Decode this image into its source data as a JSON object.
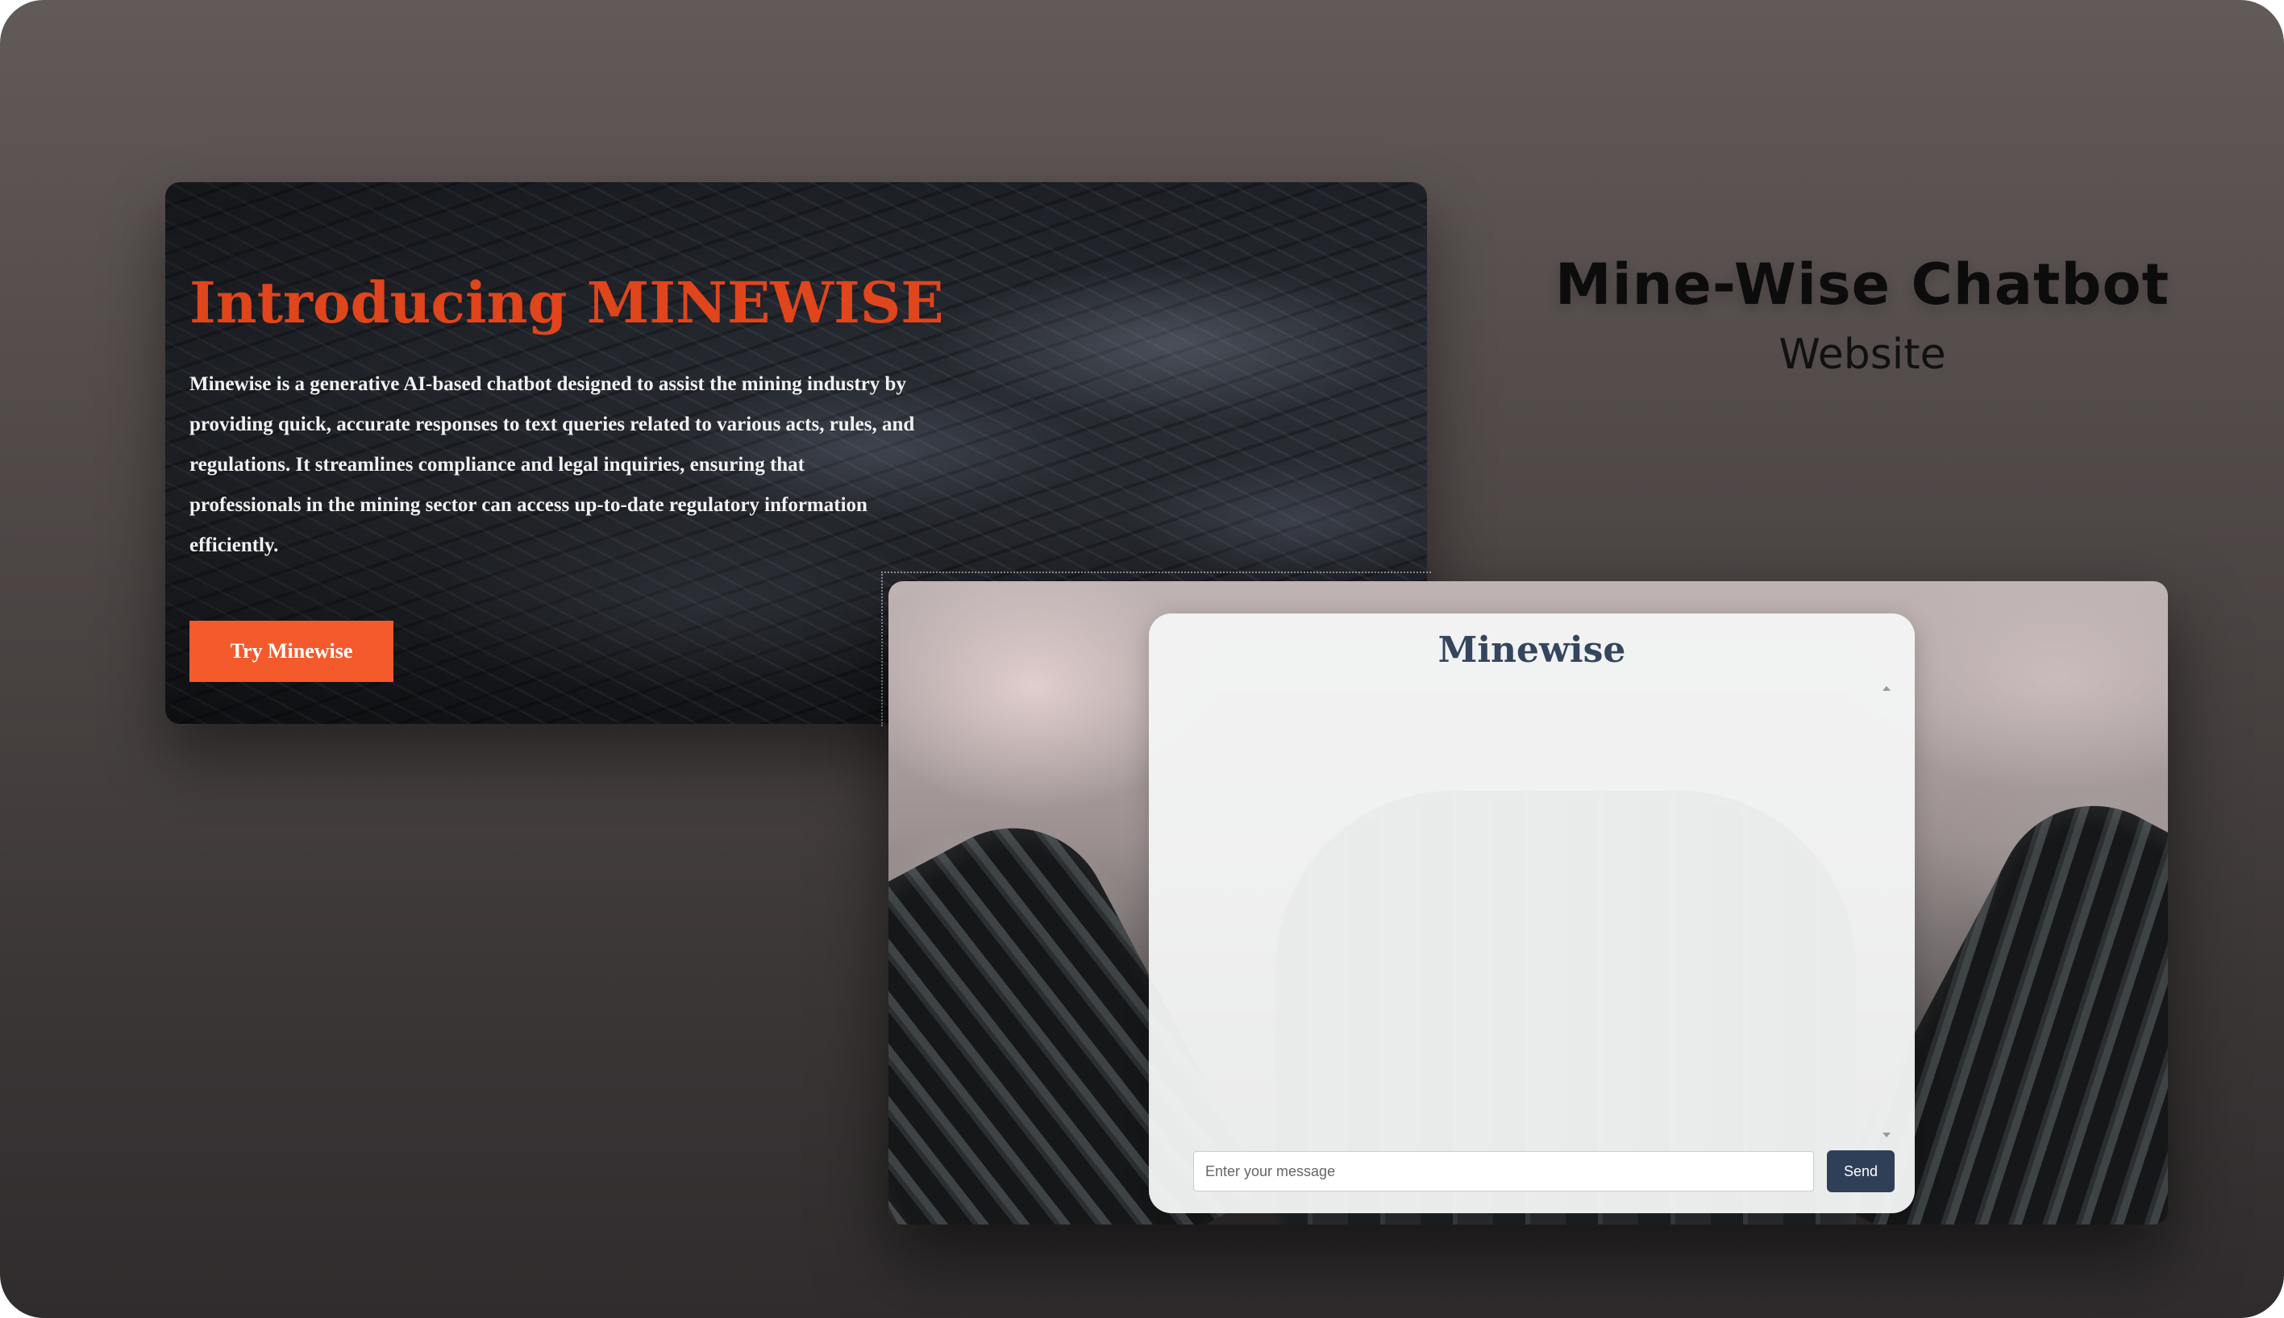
{
  "showcase": {
    "title": "Mine-Wise Chatbot",
    "subtitle": "Website"
  },
  "hero": {
    "heading": "Introducing MINEWISE",
    "description": "Minewise is a generative AI-based chatbot designed to assist the mining industry by providing quick, accurate responses to text queries related to various acts, rules, and regulations. It streamlines compliance and legal inquiries, ensuring that professionals in the mining sector can access up-to-date regulatory information efficiently.",
    "cta_label": "Try Minewise",
    "accent_color": "#e0451c",
    "button_color": "#f45a2c"
  },
  "chat": {
    "title": "Minewise",
    "input_value": "",
    "input_placeholder": "Enter your message",
    "send_label": "Send",
    "send_color": "#2f3f57",
    "scroll_icons": [
      "scroll-up-arrow-icon",
      "scroll-down-arrow-icon"
    ]
  }
}
